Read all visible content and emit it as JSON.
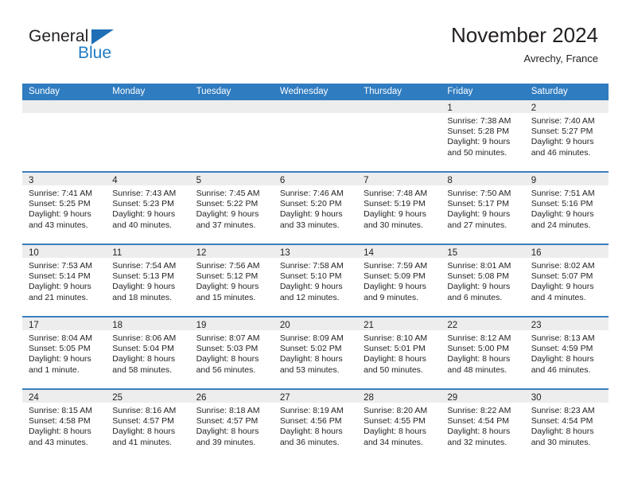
{
  "brand": {
    "name_top": "General",
    "name_bottom": "Blue",
    "accent_color": "#1f7bc4",
    "triangle_color": "#1f6fb6"
  },
  "header": {
    "title": "November 2024",
    "location": "Avrechy, France"
  },
  "theme": {
    "header_bar_color": "#2f7cc0",
    "row_divider_color": "#3d7ebd",
    "daynum_strip_color": "#ededed",
    "text_color": "#231f20"
  },
  "weekday_headers": [
    "Sunday",
    "Monday",
    "Tuesday",
    "Wednesday",
    "Thursday",
    "Friday",
    "Saturday"
  ],
  "weeks": [
    [
      {
        "day": "",
        "sunrise": "",
        "sunset": "",
        "daylight_line1": "",
        "daylight_line2": "",
        "empty": true
      },
      {
        "day": "",
        "sunrise": "",
        "sunset": "",
        "daylight_line1": "",
        "daylight_line2": "",
        "empty": true
      },
      {
        "day": "",
        "sunrise": "",
        "sunset": "",
        "daylight_line1": "",
        "daylight_line2": "",
        "empty": true
      },
      {
        "day": "",
        "sunrise": "",
        "sunset": "",
        "daylight_line1": "",
        "daylight_line2": "",
        "empty": true
      },
      {
        "day": "",
        "sunrise": "",
        "sunset": "",
        "daylight_line1": "",
        "daylight_line2": "",
        "empty": true
      },
      {
        "day": "1",
        "sunrise": "Sunrise: 7:38 AM",
        "sunset": "Sunset: 5:28 PM",
        "daylight_line1": "Daylight: 9 hours",
        "daylight_line2": "and 50 minutes.",
        "empty": false
      },
      {
        "day": "2",
        "sunrise": "Sunrise: 7:40 AM",
        "sunset": "Sunset: 5:27 PM",
        "daylight_line1": "Daylight: 9 hours",
        "daylight_line2": "and 46 minutes.",
        "empty": false
      }
    ],
    [
      {
        "day": "3",
        "sunrise": "Sunrise: 7:41 AM",
        "sunset": "Sunset: 5:25 PM",
        "daylight_line1": "Daylight: 9 hours",
        "daylight_line2": "and 43 minutes.",
        "empty": false
      },
      {
        "day": "4",
        "sunrise": "Sunrise: 7:43 AM",
        "sunset": "Sunset: 5:23 PM",
        "daylight_line1": "Daylight: 9 hours",
        "daylight_line2": "and 40 minutes.",
        "empty": false
      },
      {
        "day": "5",
        "sunrise": "Sunrise: 7:45 AM",
        "sunset": "Sunset: 5:22 PM",
        "daylight_line1": "Daylight: 9 hours",
        "daylight_line2": "and 37 minutes.",
        "empty": false
      },
      {
        "day": "6",
        "sunrise": "Sunrise: 7:46 AM",
        "sunset": "Sunset: 5:20 PM",
        "daylight_line1": "Daylight: 9 hours",
        "daylight_line2": "and 33 minutes.",
        "empty": false
      },
      {
        "day": "7",
        "sunrise": "Sunrise: 7:48 AM",
        "sunset": "Sunset: 5:19 PM",
        "daylight_line1": "Daylight: 9 hours",
        "daylight_line2": "and 30 minutes.",
        "empty": false
      },
      {
        "day": "8",
        "sunrise": "Sunrise: 7:50 AM",
        "sunset": "Sunset: 5:17 PM",
        "daylight_line1": "Daylight: 9 hours",
        "daylight_line2": "and 27 minutes.",
        "empty": false
      },
      {
        "day": "9",
        "sunrise": "Sunrise: 7:51 AM",
        "sunset": "Sunset: 5:16 PM",
        "daylight_line1": "Daylight: 9 hours",
        "daylight_line2": "and 24 minutes.",
        "empty": false
      }
    ],
    [
      {
        "day": "10",
        "sunrise": "Sunrise: 7:53 AM",
        "sunset": "Sunset: 5:14 PM",
        "daylight_line1": "Daylight: 9 hours",
        "daylight_line2": "and 21 minutes.",
        "empty": false
      },
      {
        "day": "11",
        "sunrise": "Sunrise: 7:54 AM",
        "sunset": "Sunset: 5:13 PM",
        "daylight_line1": "Daylight: 9 hours",
        "daylight_line2": "and 18 minutes.",
        "empty": false
      },
      {
        "day": "12",
        "sunrise": "Sunrise: 7:56 AM",
        "sunset": "Sunset: 5:12 PM",
        "daylight_line1": "Daylight: 9 hours",
        "daylight_line2": "and 15 minutes.",
        "empty": false
      },
      {
        "day": "13",
        "sunrise": "Sunrise: 7:58 AM",
        "sunset": "Sunset: 5:10 PM",
        "daylight_line1": "Daylight: 9 hours",
        "daylight_line2": "and 12 minutes.",
        "empty": false
      },
      {
        "day": "14",
        "sunrise": "Sunrise: 7:59 AM",
        "sunset": "Sunset: 5:09 PM",
        "daylight_line1": "Daylight: 9 hours",
        "daylight_line2": "and 9 minutes.",
        "empty": false
      },
      {
        "day": "15",
        "sunrise": "Sunrise: 8:01 AM",
        "sunset": "Sunset: 5:08 PM",
        "daylight_line1": "Daylight: 9 hours",
        "daylight_line2": "and 6 minutes.",
        "empty": false
      },
      {
        "day": "16",
        "sunrise": "Sunrise: 8:02 AM",
        "sunset": "Sunset: 5:07 PM",
        "daylight_line1": "Daylight: 9 hours",
        "daylight_line2": "and 4 minutes.",
        "empty": false
      }
    ],
    [
      {
        "day": "17",
        "sunrise": "Sunrise: 8:04 AM",
        "sunset": "Sunset: 5:05 PM",
        "daylight_line1": "Daylight: 9 hours",
        "daylight_line2": "and 1 minute.",
        "empty": false
      },
      {
        "day": "18",
        "sunrise": "Sunrise: 8:06 AM",
        "sunset": "Sunset: 5:04 PM",
        "daylight_line1": "Daylight: 8 hours",
        "daylight_line2": "and 58 minutes.",
        "empty": false
      },
      {
        "day": "19",
        "sunrise": "Sunrise: 8:07 AM",
        "sunset": "Sunset: 5:03 PM",
        "daylight_line1": "Daylight: 8 hours",
        "daylight_line2": "and 56 minutes.",
        "empty": false
      },
      {
        "day": "20",
        "sunrise": "Sunrise: 8:09 AM",
        "sunset": "Sunset: 5:02 PM",
        "daylight_line1": "Daylight: 8 hours",
        "daylight_line2": "and 53 minutes.",
        "empty": false
      },
      {
        "day": "21",
        "sunrise": "Sunrise: 8:10 AM",
        "sunset": "Sunset: 5:01 PM",
        "daylight_line1": "Daylight: 8 hours",
        "daylight_line2": "and 50 minutes.",
        "empty": false
      },
      {
        "day": "22",
        "sunrise": "Sunrise: 8:12 AM",
        "sunset": "Sunset: 5:00 PM",
        "daylight_line1": "Daylight: 8 hours",
        "daylight_line2": "and 48 minutes.",
        "empty": false
      },
      {
        "day": "23",
        "sunrise": "Sunrise: 8:13 AM",
        "sunset": "Sunset: 4:59 PM",
        "daylight_line1": "Daylight: 8 hours",
        "daylight_line2": "and 46 minutes.",
        "empty": false
      }
    ],
    [
      {
        "day": "24",
        "sunrise": "Sunrise: 8:15 AM",
        "sunset": "Sunset: 4:58 PM",
        "daylight_line1": "Daylight: 8 hours",
        "daylight_line2": "and 43 minutes.",
        "empty": false
      },
      {
        "day": "25",
        "sunrise": "Sunrise: 8:16 AM",
        "sunset": "Sunset: 4:57 PM",
        "daylight_line1": "Daylight: 8 hours",
        "daylight_line2": "and 41 minutes.",
        "empty": false
      },
      {
        "day": "26",
        "sunrise": "Sunrise: 8:18 AM",
        "sunset": "Sunset: 4:57 PM",
        "daylight_line1": "Daylight: 8 hours",
        "daylight_line2": "and 39 minutes.",
        "empty": false
      },
      {
        "day": "27",
        "sunrise": "Sunrise: 8:19 AM",
        "sunset": "Sunset: 4:56 PM",
        "daylight_line1": "Daylight: 8 hours",
        "daylight_line2": "and 36 minutes.",
        "empty": false
      },
      {
        "day": "28",
        "sunrise": "Sunrise: 8:20 AM",
        "sunset": "Sunset: 4:55 PM",
        "daylight_line1": "Daylight: 8 hours",
        "daylight_line2": "and 34 minutes.",
        "empty": false
      },
      {
        "day": "29",
        "sunrise": "Sunrise: 8:22 AM",
        "sunset": "Sunset: 4:54 PM",
        "daylight_line1": "Daylight: 8 hours",
        "daylight_line2": "and 32 minutes.",
        "empty": false
      },
      {
        "day": "30",
        "sunrise": "Sunrise: 8:23 AM",
        "sunset": "Sunset: 4:54 PM",
        "daylight_line1": "Daylight: 8 hours",
        "daylight_line2": "and 30 minutes.",
        "empty": false
      }
    ]
  ]
}
